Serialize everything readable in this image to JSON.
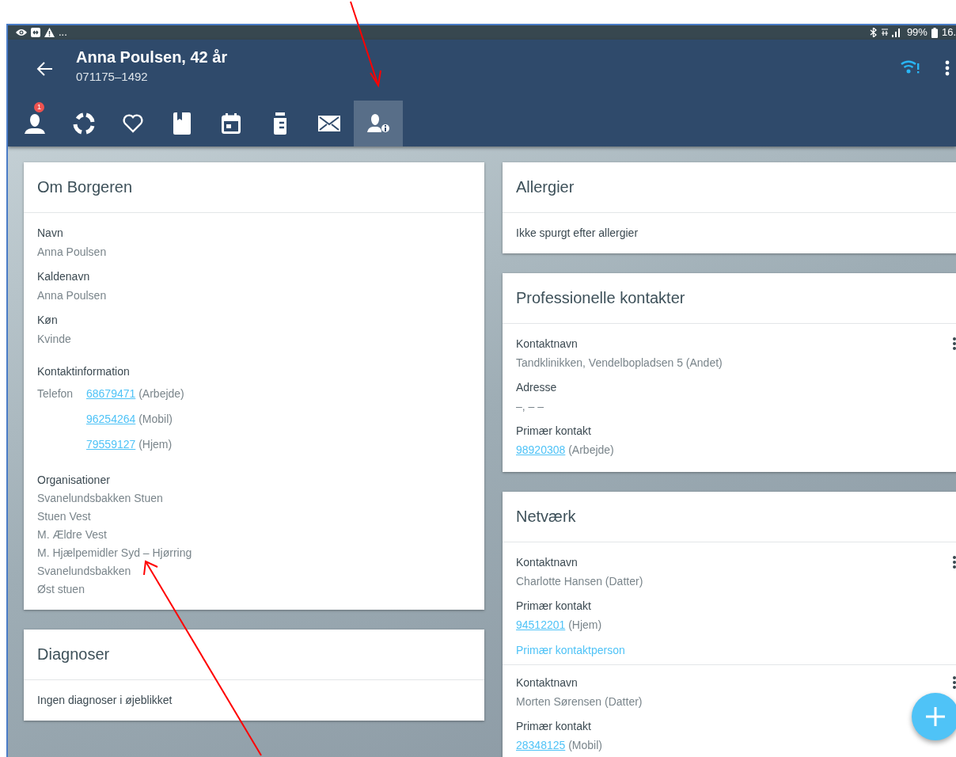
{
  "status_bar": {
    "overflow": "...",
    "battery": "99%",
    "time": "16."
  },
  "header": {
    "title": "Anna Poulsen, 42 år",
    "subtitle": "071175–1492"
  },
  "tabs": [
    {
      "selected": false,
      "badge": "1"
    },
    {
      "selected": false
    },
    {
      "selected": false
    },
    {
      "selected": false
    },
    {
      "selected": false
    },
    {
      "selected": false
    },
    {
      "selected": false
    },
    {
      "selected": true
    }
  ],
  "left_column": [
    {
      "title": "Om Borgeren",
      "sections": [
        {
          "kind": "field",
          "label": "Navn",
          "value": "Anna Poulsen"
        },
        {
          "kind": "field",
          "label": "Kaldenavn",
          "value": "Anna Poulsen"
        },
        {
          "kind": "field",
          "label": "Køn",
          "value": "Kvinde"
        },
        {
          "kind": "phones",
          "label": "Kontaktinformation",
          "phone_label": "Telefon",
          "phones": [
            {
              "number": "68679471",
              "type": "(Arbejde)"
            },
            {
              "number": "96254264",
              "type": "(Mobil)"
            },
            {
              "number": "79559127",
              "type": "(Hjem)"
            }
          ]
        },
        {
          "kind": "list",
          "label": "Organisationer",
          "items": [
            "Svanelundsbakken Stuen",
            "Stuen Vest",
            "M. Ældre Vest",
            "M. Hjælpemidler Syd – Hjørring",
            "Svanelundsbakken",
            "Øst stuen"
          ]
        }
      ]
    },
    {
      "title": "Diagnoser",
      "sections": [
        {
          "kind": "note",
          "text": "Ingen diagnoser i øjeblikket"
        }
      ]
    }
  ],
  "right_column": [
    {
      "title": "Allergier",
      "sections": [
        {
          "kind": "note",
          "text": "Ikke spurgt efter allergier"
        }
      ]
    },
    {
      "title": "Professionelle kontakter",
      "sections": [
        {
          "kind": "contact",
          "rows": [
            {
              "kind": "field",
              "label": "Kontaktnavn",
              "value": "Tandklinikken, Vendelbopladsen 5 (Andet)"
            },
            {
              "kind": "field",
              "label": "Adresse",
              "value": "–, – –"
            },
            {
              "kind": "phone",
              "label": "Primær kontakt",
              "number": "98920308",
              "type": "(Arbejde)"
            }
          ]
        }
      ]
    },
    {
      "title": "Netværk",
      "sections": [
        {
          "kind": "contact",
          "rows": [
            {
              "kind": "field",
              "label": "Kontaktnavn",
              "value": "Charlotte Hansen (Datter)"
            },
            {
              "kind": "phone",
              "label": "Primær kontakt",
              "number": "94512201",
              "type": "(Hjem)"
            },
            {
              "kind": "link",
              "text": "Primær kontaktperson"
            }
          ]
        },
        {
          "kind": "contact",
          "rows": [
            {
              "kind": "field",
              "label": "Kontaktnavn",
              "value": "Morten Sørensen (Datter)"
            },
            {
              "kind": "phone",
              "label": "Primær kontakt",
              "number": "28348125",
              "type": "(Mobil)"
            }
          ]
        }
      ]
    }
  ]
}
